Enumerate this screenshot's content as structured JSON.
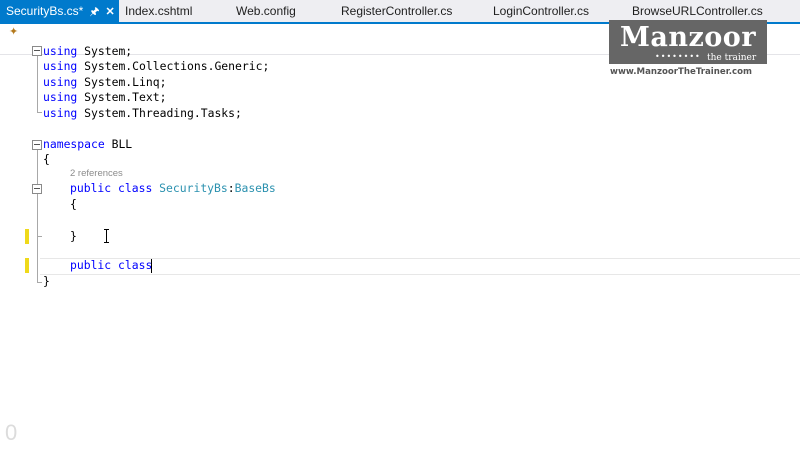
{
  "tabs": [
    {
      "label": "SecurityBs.cs*",
      "active": true
    },
    {
      "label": "Index.cshtml"
    },
    {
      "label": "Web.config"
    },
    {
      "label": "RegisterController.cs"
    },
    {
      "label": "LoginController.cs"
    },
    {
      "label": "BrowseURLController.cs"
    }
  ],
  "code": {
    "using1": "System;",
    "using2": "System.Collections.Generic;",
    "using3": "System.Linq;",
    "using4": "System.Text;",
    "using5": "System.Threading.Tasks;",
    "kw_using": "using",
    "kw_namespace": "namespace",
    "namespace_name": "BLL",
    "brace_open": "{",
    "brace_close": "}",
    "references": "2 references",
    "kw_public": "public",
    "kw_class": "class",
    "class_name": "SecurityBs",
    "colon": ":",
    "base_class": "BaseBs"
  },
  "zoom_digit": "0",
  "watermark": {
    "name": "Manzoor",
    "tagline": "the trainer",
    "url": "www.ManzoorTheTrainer.com"
  },
  "colors": {
    "accent": "#007ACC",
    "keyword": "#0000FF",
    "type": "#2B91AF",
    "change_marker": "#EFD91A"
  }
}
